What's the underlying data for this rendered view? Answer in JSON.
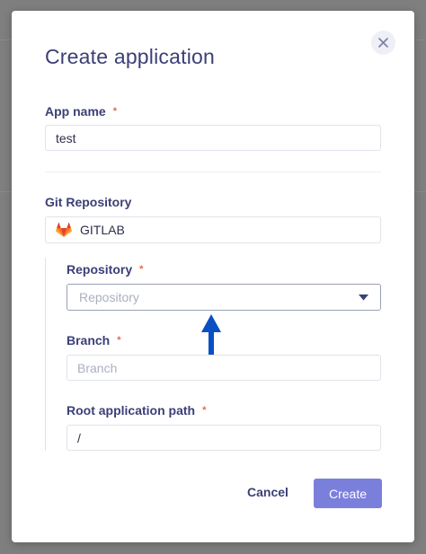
{
  "modal": {
    "title": "Create application",
    "close_icon": "close-icon"
  },
  "app_name": {
    "label": "App name",
    "required_mark": "*",
    "value": "test"
  },
  "git_repository": {
    "label": "Git Repository",
    "provider_icon": "gitlab-icon",
    "provider": "GITLAB"
  },
  "repository": {
    "label": "Repository",
    "required_mark": "*",
    "placeholder": "Repository",
    "dropdown_icon": "caret-down-icon"
  },
  "branch": {
    "label": "Branch",
    "required_mark": "*",
    "placeholder": "Branch"
  },
  "root_path": {
    "label": "Root application path",
    "required_mark": "*",
    "value": "/"
  },
  "annotation": {
    "icon": "arrow-up-icon",
    "color": "#0a4fc4"
  },
  "footer": {
    "cancel_label": "Cancel",
    "create_label": "Create"
  },
  "colors": {
    "heading": "#3b3f77",
    "required": "#e8684a",
    "primary": "#7b7fdc",
    "overlay": "#7f7f7f"
  }
}
